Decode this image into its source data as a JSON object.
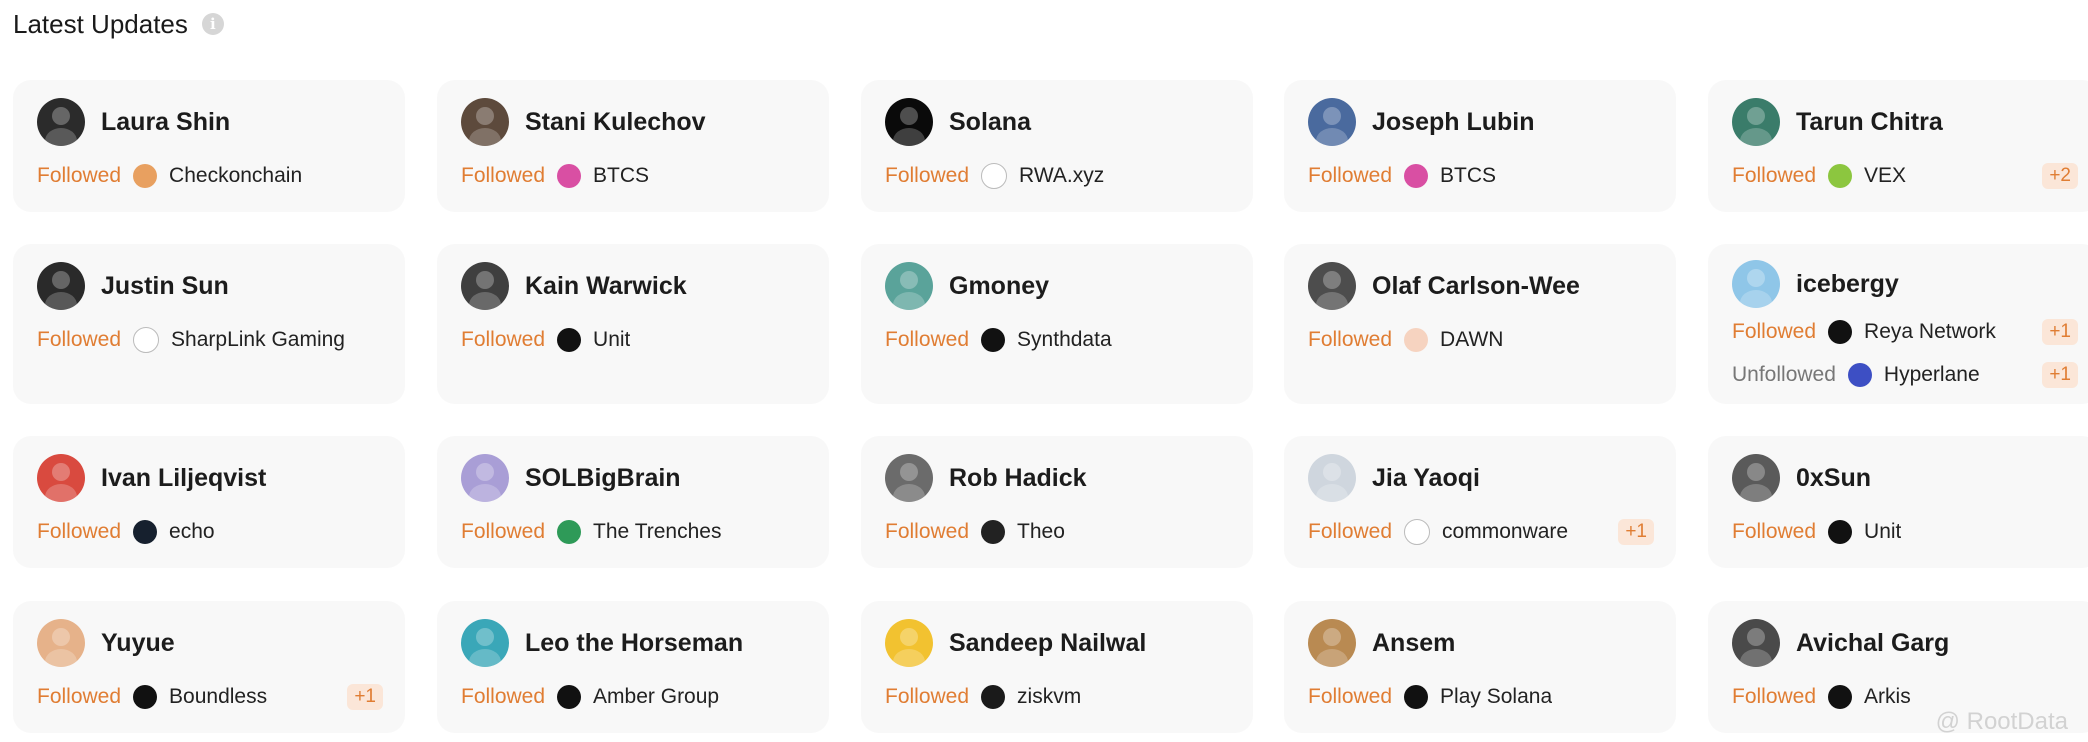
{
  "page": {
    "title": "Latest Updates",
    "info_icon": "i",
    "watermark": "@ RootData"
  },
  "colors": {
    "followed": "#e07d33",
    "unfollowed": "#777777",
    "badge_bg": "#fbe6d8",
    "card_bg": "#f8f8f8"
  },
  "cards": [
    {
      "name": "Laura Shin",
      "avatar": "#2b2b2b",
      "actions": [
        {
          "status": "Followed",
          "project": "Checkonchain",
          "icon": "#e8a060",
          "icon_name": "checkonchain-logo-icon"
        }
      ]
    },
    {
      "name": "Stani Kulechov",
      "avatar": "#5d4a3c",
      "actions": [
        {
          "status": "Followed",
          "project": "BTCS",
          "icon": "#d94fa3",
          "icon_name": "btcs-logo-icon"
        }
      ]
    },
    {
      "name": "Solana",
      "avatar": "#0a0a0a",
      "actions": [
        {
          "status": "Followed",
          "project": "RWA.xyz",
          "icon": "#ffffff",
          "icon_name": "globe-icon"
        }
      ]
    },
    {
      "name": "Joseph Lubin",
      "avatar": "#4a6a9e",
      "actions": [
        {
          "status": "Followed",
          "project": "BTCS",
          "icon": "#d94fa3",
          "icon_name": "btcs-logo-icon"
        }
      ]
    },
    {
      "name": "Tarun Chitra",
      "avatar": "#3a7c6a",
      "actions": [
        {
          "status": "Followed",
          "project": "VEX",
          "icon": "#8cc63f",
          "icon_name": "vex-logo-icon",
          "extra": "+2"
        }
      ]
    },
    {
      "name": "Justin Sun",
      "avatar": "#2a2a2a",
      "actions": [
        {
          "status": "Followed",
          "project": "SharpLink Gaming",
          "icon": "#ffffff",
          "icon_name": "sharplink-logo-icon"
        }
      ]
    },
    {
      "name": "Kain Warwick",
      "avatar": "#3f3f3f",
      "actions": [
        {
          "status": "Followed",
          "project": "Unit",
          "icon": "#111111",
          "icon_name": "unit-logo-icon"
        }
      ]
    },
    {
      "name": "Gmoney",
      "avatar": "#5aa39a",
      "actions": [
        {
          "status": "Followed",
          "project": "Synthdata",
          "icon": "#111111",
          "icon_name": "synthdata-logo-icon"
        }
      ]
    },
    {
      "name": "Olaf Carlson-Wee",
      "avatar": "#4d4d4d",
      "actions": [
        {
          "status": "Followed",
          "project": "DAWN",
          "icon": "#f6d3c0",
          "icon_name": "dawn-logo-icon"
        }
      ]
    },
    {
      "name": "icebergy",
      "avatar": "#8fc6e8",
      "actions": [
        {
          "status": "Followed",
          "project": "Reya Network",
          "icon": "#111111",
          "icon_name": "reya-logo-icon",
          "extra": "+1"
        },
        {
          "status": "Unfollowed",
          "project": "Hyperlane",
          "icon": "#3d4fc4",
          "icon_name": "hyperlane-logo-icon",
          "extra": "+1"
        }
      ]
    },
    {
      "name": "Ivan Liljeqvist",
      "avatar": "#d94a3f",
      "actions": [
        {
          "status": "Followed",
          "project": "echo",
          "icon": "#16202e",
          "icon_name": "echo-logo-icon"
        }
      ]
    },
    {
      "name": "SOLBigBrain",
      "avatar": "#a99ed6",
      "actions": [
        {
          "status": "Followed",
          "project": "The Trenches",
          "icon": "#2e9a58",
          "icon_name": "trenches-logo-icon"
        }
      ]
    },
    {
      "name": "Rob Hadick",
      "avatar": "#6b6b6b",
      "actions": [
        {
          "status": "Followed",
          "project": "Theo",
          "icon": "#222222",
          "icon_name": "theo-logo-icon"
        }
      ]
    },
    {
      "name": "Jia Yaoqi",
      "avatar": "#cfd6de",
      "actions": [
        {
          "status": "Followed",
          "project": "commonware",
          "icon": "#ffffff",
          "icon_name": "commonware-logo-icon",
          "extra": "+1"
        }
      ]
    },
    {
      "name": "0xSun",
      "avatar": "#5a5a5a",
      "actions": [
        {
          "status": "Followed",
          "project": "Unit",
          "icon": "#111111",
          "icon_name": "unit-logo-icon"
        }
      ]
    },
    {
      "name": "Yuyue",
      "avatar": "#e6b28a",
      "actions": [
        {
          "status": "Followed",
          "project": "Boundless",
          "icon": "#111111",
          "icon_name": "boundless-logo-icon",
          "extra": "+1"
        }
      ]
    },
    {
      "name": "Leo the Horseman",
      "avatar": "#3aa7b8",
      "actions": [
        {
          "status": "Followed",
          "project": "Amber Group",
          "icon": "#111111",
          "icon_name": "amber-logo-icon"
        }
      ]
    },
    {
      "name": "Sandeep Nailwal",
      "avatar": "#f2c230",
      "actions": [
        {
          "status": "Followed",
          "project": "ziskvm",
          "icon": "#1a1a1a",
          "icon_name": "ziskvm-logo-icon"
        }
      ]
    },
    {
      "name": "Ansem",
      "avatar": "#b98a52",
      "actions": [
        {
          "status": "Followed",
          "project": "Play Solana",
          "icon": "#111111",
          "icon_name": "play-solana-logo-icon"
        }
      ]
    },
    {
      "name": "Avichal Garg",
      "avatar": "#4a4a4a",
      "actions": [
        {
          "status": "Followed",
          "project": "Arkis",
          "icon": "#111111",
          "icon_name": "arkis-logo-icon"
        }
      ]
    }
  ]
}
